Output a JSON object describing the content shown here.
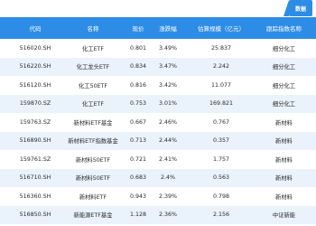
{
  "logo_text": "数据",
  "headers": [
    "代码",
    "名称",
    "现价",
    "涨跌幅",
    "估算规模（亿元）",
    "跟踪指数名称"
  ],
  "rows": [
    {
      "code": "516020.SH",
      "name": "化工ETF",
      "price": "0.801",
      "change": "3.49%",
      "size": "25.837",
      "index": "细分化工"
    },
    {
      "code": "516220.SH",
      "name": "化工龙头ETF",
      "price": "0.834",
      "change": "3.47%",
      "size": "2.242",
      "index": "细分化工"
    },
    {
      "code": "516120.SH",
      "name": "化工50ETF",
      "price": "0.816",
      "change": "3.42%",
      "size": "11.077",
      "index": "细分化工"
    },
    {
      "code": "159870.SZ",
      "name": "化工ETF",
      "price": "0.753",
      "change": "3.01%",
      "size": "169.821",
      "index": "细分化工"
    },
    {
      "code": "159763.SZ",
      "name": "新材料ETF基金",
      "price": "0.667",
      "change": "2.46%",
      "size": "0.767",
      "index": "新材料"
    },
    {
      "code": "516890.SH",
      "name": "新材料ETF指数基金",
      "price": "0.713",
      "change": "2.44%",
      "size": "0.357",
      "index": "新材料"
    },
    {
      "code": "159761.SZ",
      "name": "新材料50ETF",
      "price": "0.721",
      "change": "2.41%",
      "size": "1.757",
      "index": "新材料"
    },
    {
      "code": "516710.SH",
      "name": "新材料50ETF",
      "price": "0.683",
      "change": "2.4%",
      "size": "0.563",
      "index": "新材料"
    },
    {
      "code": "516360.SH",
      "name": "新材料ETF",
      "price": "0.943",
      "change": "2.39%",
      "size": "0.798",
      "index": "新材料"
    },
    {
      "code": "516850.SH",
      "name": "新能源ETF基金",
      "price": "1.128",
      "change": "2.36%",
      "size": "2.156",
      "index": "中证新能"
    }
  ]
}
